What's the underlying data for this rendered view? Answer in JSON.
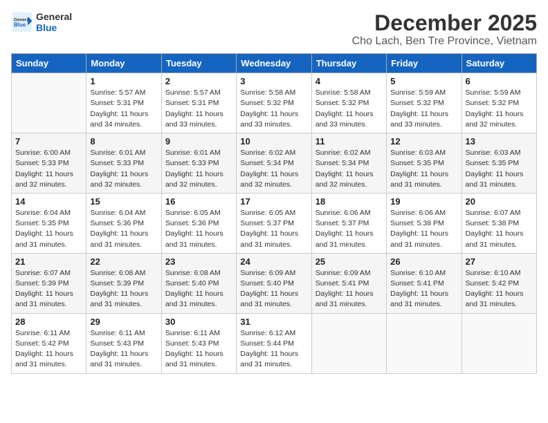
{
  "header": {
    "logo_general": "General",
    "logo_blue": "Blue",
    "title": "December 2025",
    "subtitle": "Cho Lach, Ben Tre Province, Vietnam"
  },
  "days_of_week": [
    "Sunday",
    "Monday",
    "Tuesday",
    "Wednesday",
    "Thursday",
    "Friday",
    "Saturday"
  ],
  "weeks": [
    [
      {
        "day": "",
        "info": ""
      },
      {
        "day": "1",
        "info": "Sunrise: 5:57 AM\nSunset: 5:31 PM\nDaylight: 11 hours\nand 34 minutes."
      },
      {
        "day": "2",
        "info": "Sunrise: 5:57 AM\nSunset: 5:31 PM\nDaylight: 11 hours\nand 33 minutes."
      },
      {
        "day": "3",
        "info": "Sunrise: 5:58 AM\nSunset: 5:32 PM\nDaylight: 11 hours\nand 33 minutes."
      },
      {
        "day": "4",
        "info": "Sunrise: 5:58 AM\nSunset: 5:32 PM\nDaylight: 11 hours\nand 33 minutes."
      },
      {
        "day": "5",
        "info": "Sunrise: 5:59 AM\nSunset: 5:32 PM\nDaylight: 11 hours\nand 33 minutes."
      },
      {
        "day": "6",
        "info": "Sunrise: 5:59 AM\nSunset: 5:32 PM\nDaylight: 11 hours\nand 32 minutes."
      }
    ],
    [
      {
        "day": "7",
        "info": "Sunrise: 6:00 AM\nSunset: 5:33 PM\nDaylight: 11 hours\nand 32 minutes."
      },
      {
        "day": "8",
        "info": "Sunrise: 6:01 AM\nSunset: 5:33 PM\nDaylight: 11 hours\nand 32 minutes."
      },
      {
        "day": "9",
        "info": "Sunrise: 6:01 AM\nSunset: 5:33 PM\nDaylight: 11 hours\nand 32 minutes."
      },
      {
        "day": "10",
        "info": "Sunrise: 6:02 AM\nSunset: 5:34 PM\nDaylight: 11 hours\nand 32 minutes."
      },
      {
        "day": "11",
        "info": "Sunrise: 6:02 AM\nSunset: 5:34 PM\nDaylight: 11 hours\nand 32 minutes."
      },
      {
        "day": "12",
        "info": "Sunrise: 6:03 AM\nSunset: 5:35 PM\nDaylight: 11 hours\nand 31 minutes."
      },
      {
        "day": "13",
        "info": "Sunrise: 6:03 AM\nSunset: 5:35 PM\nDaylight: 11 hours\nand 31 minutes."
      }
    ],
    [
      {
        "day": "14",
        "info": "Sunrise: 6:04 AM\nSunset: 5:35 PM\nDaylight: 11 hours\nand 31 minutes."
      },
      {
        "day": "15",
        "info": "Sunrise: 6:04 AM\nSunset: 5:36 PM\nDaylight: 11 hours\nand 31 minutes."
      },
      {
        "day": "16",
        "info": "Sunrise: 6:05 AM\nSunset: 5:36 PM\nDaylight: 11 hours\nand 31 minutes."
      },
      {
        "day": "17",
        "info": "Sunrise: 6:05 AM\nSunset: 5:37 PM\nDaylight: 11 hours\nand 31 minutes."
      },
      {
        "day": "18",
        "info": "Sunrise: 6:06 AM\nSunset: 5:37 PM\nDaylight: 11 hours\nand 31 minutes."
      },
      {
        "day": "19",
        "info": "Sunrise: 6:06 AM\nSunset: 5:38 PM\nDaylight: 11 hours\nand 31 minutes."
      },
      {
        "day": "20",
        "info": "Sunrise: 6:07 AM\nSunset: 5:38 PM\nDaylight: 11 hours\nand 31 minutes."
      }
    ],
    [
      {
        "day": "21",
        "info": "Sunrise: 6:07 AM\nSunset: 5:39 PM\nDaylight: 11 hours\nand 31 minutes."
      },
      {
        "day": "22",
        "info": "Sunrise: 6:08 AM\nSunset: 5:39 PM\nDaylight: 11 hours\nand 31 minutes."
      },
      {
        "day": "23",
        "info": "Sunrise: 6:08 AM\nSunset: 5:40 PM\nDaylight: 11 hours\nand 31 minutes."
      },
      {
        "day": "24",
        "info": "Sunrise: 6:09 AM\nSunset: 5:40 PM\nDaylight: 11 hours\nand 31 minutes."
      },
      {
        "day": "25",
        "info": "Sunrise: 6:09 AM\nSunset: 5:41 PM\nDaylight: 11 hours\nand 31 minutes."
      },
      {
        "day": "26",
        "info": "Sunrise: 6:10 AM\nSunset: 5:41 PM\nDaylight: 11 hours\nand 31 minutes."
      },
      {
        "day": "27",
        "info": "Sunrise: 6:10 AM\nSunset: 5:42 PM\nDaylight: 11 hours\nand 31 minutes."
      }
    ],
    [
      {
        "day": "28",
        "info": "Sunrise: 6:11 AM\nSunset: 5:42 PM\nDaylight: 11 hours\nand 31 minutes."
      },
      {
        "day": "29",
        "info": "Sunrise: 6:11 AM\nSunset: 5:43 PM\nDaylight: 11 hours\nand 31 minutes."
      },
      {
        "day": "30",
        "info": "Sunrise: 6:11 AM\nSunset: 5:43 PM\nDaylight: 11 hours\nand 31 minutes."
      },
      {
        "day": "31",
        "info": "Sunrise: 6:12 AM\nSunset: 5:44 PM\nDaylight: 11 hours\nand 31 minutes."
      },
      {
        "day": "",
        "info": ""
      },
      {
        "day": "",
        "info": ""
      },
      {
        "day": "",
        "info": ""
      }
    ]
  ]
}
